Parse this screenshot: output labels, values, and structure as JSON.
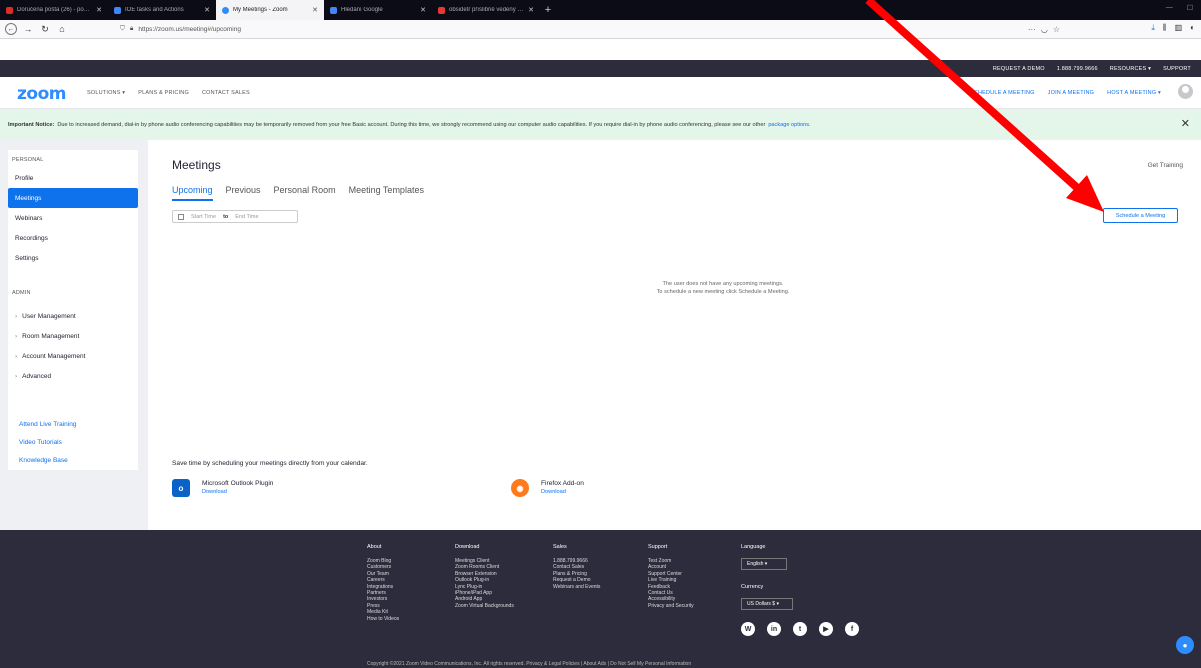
{
  "browser": {
    "tabs": [
      {
        "label": "Doručená pošta (26) - pokar...",
        "color": "#d93025",
        "active": false
      },
      {
        "label": "IOE tasks and Actions",
        "color": "#4285f4",
        "active": false
      },
      {
        "label": "My Meetings - Zoom",
        "color": "#2d8cff",
        "active": true
      },
      {
        "label": "Hledání Google",
        "color": "#4285f4",
        "active": false
      },
      {
        "label": "obsidetr příslibně vedený do -",
        "color": "#e53935",
        "active": false
      }
    ],
    "new_tab": "+",
    "url": "https://zoom.us/meeting#/upcoming",
    "win_min": "—",
    "win_max": "☐"
  },
  "zoom_top": {
    "request_demo": "REQUEST A DEMO",
    "phone": "1.888.799.9666",
    "resources": "RESOURCES ▾",
    "support": "SUPPORT"
  },
  "header": {
    "logo": "zoom",
    "nav": [
      "SOLUTIONS ▾",
      "PLANS & PRICING",
      "CONTACT SALES"
    ],
    "right_nav": [
      "SCHEDULE A MEETING",
      "JOIN A MEETING",
      "HOST A MEETING ▾"
    ]
  },
  "notice": {
    "bold": "Important Notice:",
    "text": "Due to increased demand, dial-in by phone audio conferencing capabilities may be temporarily removed from your free Basic account. During this time, we strongly recommend using our computer audio capabilities. If you require dial-in by phone audio conferencing, please see our other",
    "link": "package options."
  },
  "sidebar": {
    "personal_header": "PERSONAL",
    "personal_items": [
      "Profile",
      "Meetings",
      "Webinars",
      "Recordings",
      "Settings"
    ],
    "admin_header": "ADMIN",
    "admin_items": [
      "User Management",
      "Room Management",
      "Account Management",
      "Advanced"
    ],
    "links": [
      "Attend Live Training",
      "Video Tutorials",
      "Knowledge Base"
    ]
  },
  "main": {
    "title": "Meetings",
    "get_training": "Get Training",
    "tabs": [
      "Upcoming",
      "Previous",
      "Personal Room",
      "Meeting Templates"
    ],
    "start_placeholder": "Start Time",
    "to": "to",
    "end_placeholder": "End Time",
    "schedule_button": "Schedule a Meeting",
    "empty_line1": "The user does not have any upcoming meetings.",
    "empty_line2": "To schedule a new meeting click Schedule a Meeting.",
    "calendar_title": "Save time by scheduling your meetings directly from your calendar.",
    "outlook_name": "Microsoft Outlook Plugin",
    "outlook_download": "Download",
    "firefox_name": "Firefox Add-on",
    "firefox_download": "Download"
  },
  "footer": {
    "columns": [
      {
        "head": "About",
        "links": [
          "Zoom Blog",
          "Customers",
          "Our Team",
          "Careers",
          "Integrations",
          "Partners",
          "Investors",
          "Press",
          "Media Kit",
          "How to Videos"
        ]
      },
      {
        "head": "Download",
        "links": [
          "Meetings Client",
          "Zoom Rooms Client",
          "Browser Extension",
          "Outlook Plug-in",
          "Lync Plug-in",
          "iPhone/iPad App",
          "Android App",
          "Zoom Virtual Backgrounds"
        ]
      },
      {
        "head": "Sales",
        "links": [
          "1.888.799.9666",
          "Contact Sales",
          "Plans & Pricing",
          "Request a Demo",
          "Webinars and Events"
        ]
      },
      {
        "head": "Support",
        "links": [
          "Test Zoom",
          "Account",
          "Support Center",
          "Live Training",
          "Feedback",
          "Contact Us",
          "Accessibility",
          "Privacy and Security"
        ]
      }
    ],
    "language_head": "Language",
    "language_value": "English ▾",
    "currency_head": "Currency",
    "currency_value": "US Dollars $ ▾",
    "copyright": "Copyright ©2021 Zoom Video Communications, Inc. All rights reserved.   Privacy & Legal Policies  |  About Ads  |  Do Not Sell My Personal Information"
  }
}
